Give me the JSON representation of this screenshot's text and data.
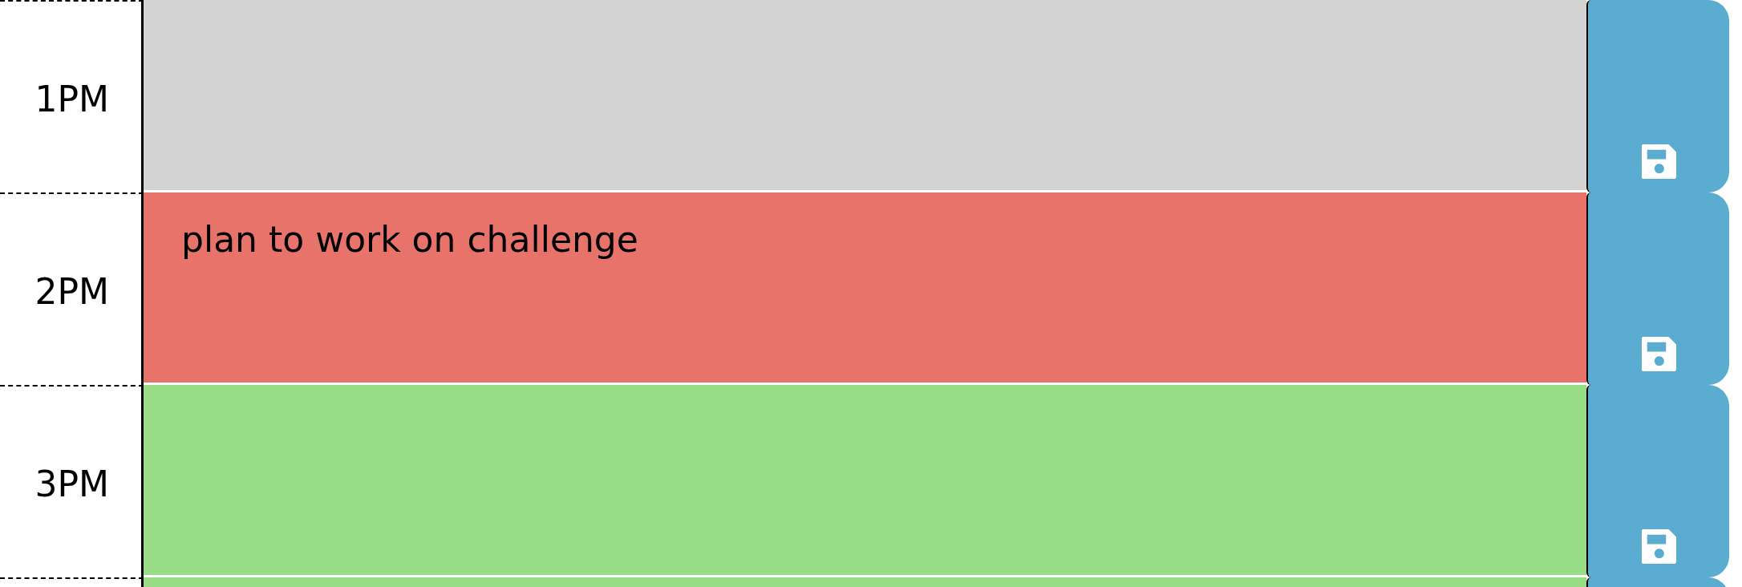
{
  "rows": [
    {
      "hour": "1PM",
      "kind": "past"
    },
    {
      "hour": "2PM",
      "kind": "present",
      "text": "plan to work on challenge"
    },
    {
      "hour": "3PM",
      "kind": "future"
    },
    {
      "kind": "future"
    }
  ]
}
